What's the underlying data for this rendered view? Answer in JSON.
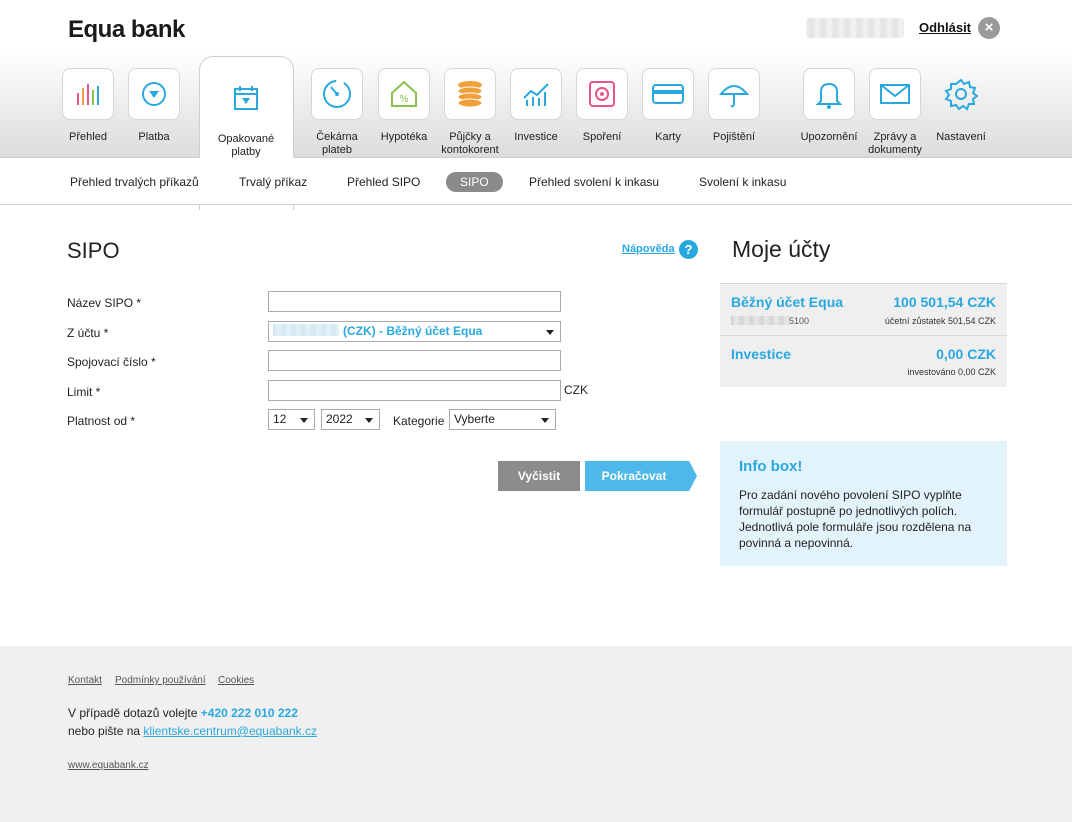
{
  "header": {
    "logo": "Equa bank",
    "logout_label": "Odhlásit"
  },
  "nav": {
    "items": [
      {
        "label": "Přehled",
        "icon": "bar-chart-icon"
      },
      {
        "label": "Platba",
        "icon": "payment-icon"
      },
      {
        "label": "Opakované platby",
        "icon": "calendar-icon"
      },
      {
        "label": "Čekárna plateb",
        "icon": "clock-icon"
      },
      {
        "label": "Hypotéka",
        "icon": "house-percent-icon"
      },
      {
        "label": "Půjčky a kontokorent",
        "icon": "coins-icon"
      },
      {
        "label": "Investice",
        "icon": "investment-icon"
      },
      {
        "label": "Spoření",
        "icon": "safe-icon"
      },
      {
        "label": "Karty",
        "icon": "card-icon"
      },
      {
        "label": "Pojištění",
        "icon": "umbrella-icon"
      },
      {
        "label": "Upozornění",
        "icon": "bell-icon"
      },
      {
        "label": "Zprávy a dokumenty",
        "icon": "envelope-icon"
      },
      {
        "label": "Nastavení",
        "icon": "gear-icon"
      }
    ]
  },
  "subnav": {
    "items": [
      "Přehled trvalých příkazů",
      "Trvalý příkaz",
      "Přehled SIPO",
      "SIPO",
      "Přehled svolení k inkasu",
      "Svolení k inkasu"
    ],
    "active": "SIPO"
  },
  "form": {
    "title": "SIPO",
    "help_label": "Nápověda",
    "help_icon": "?",
    "labels": {
      "name": "Název SIPO *",
      "from_account": "Z účtu *",
      "connection_number": "Spojovací číslo *",
      "limit": "Limit *",
      "valid_from": "Platnost od *",
      "category": "Kategorie"
    },
    "values": {
      "name": "",
      "from_account": "(CZK) - Běžný účet Equa",
      "connection_number": "",
      "limit": "",
      "month": "12",
      "year": "2022",
      "category": "Vyberte"
    },
    "currency": "CZK",
    "clear_button": "Vyčistit",
    "continue_button": "Pokračovat"
  },
  "accounts": {
    "title": "Moje účty",
    "items": [
      {
        "name": "Běžný účet Equa",
        "amount": "100 501,54 CZK",
        "number_suffix": "5100",
        "sub": "účetní zůstatek 501,54 CZK"
      },
      {
        "name": "Investice",
        "amount": "0,00 CZK",
        "sub": "investováno 0,00 CZK"
      }
    ]
  },
  "infobox": {
    "title": "Info box!",
    "text": "Pro zadání nového povolení SIPO vyplňte formulář postupně po jednotlivých polích. Jednotlivá pole formuláře jsou rozdělena na povinná a nepovinná."
  },
  "footer": {
    "links": [
      "Kontakt",
      "Podmínky používání",
      "Cookies"
    ],
    "contact_text": "V případě dotazů volejte",
    "phone": "+420 222 010 222",
    "email_text": "nebo pište na",
    "email": "klientske.centrum@equabank.cz",
    "website": "www.equabank.cz"
  },
  "colors": {
    "accent": "#29a8e0",
    "button_gray": "#8c8c8c",
    "infobox_bg": "#e3f3fb",
    "account_bg": "#efefef"
  }
}
